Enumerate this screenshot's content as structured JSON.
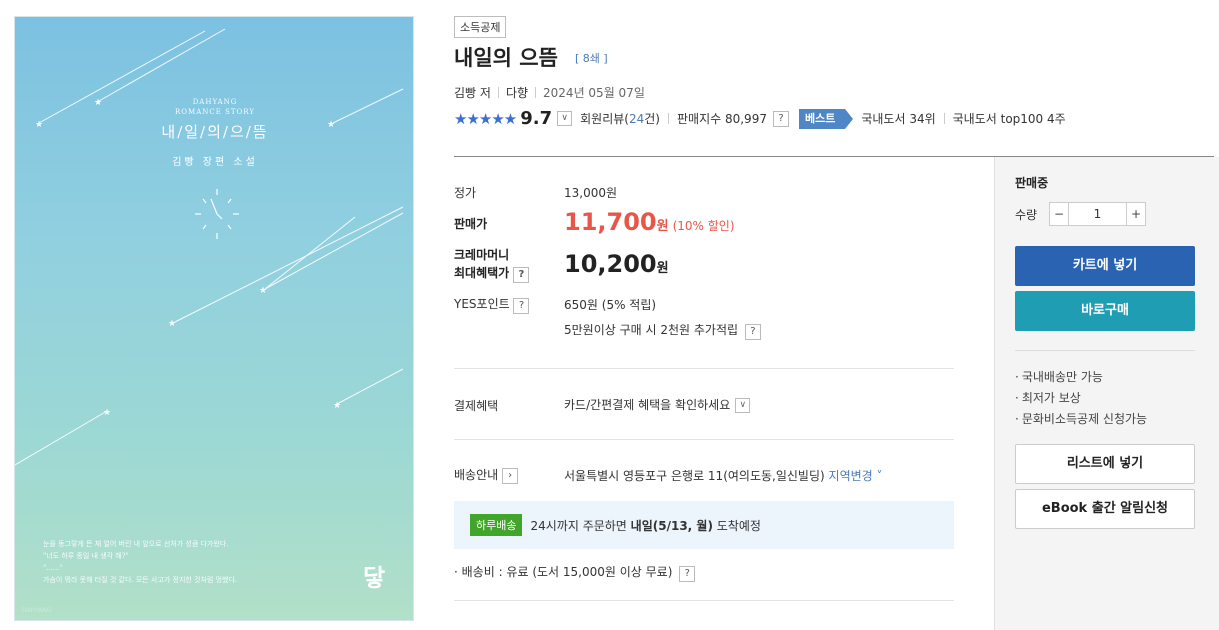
{
  "cover": {
    "publisher_line1": "DAHYANG",
    "publisher_line2": "ROMANCE STORY",
    "title": "내/일/의/으/뜸",
    "author": "김빵 장편 소설",
    "blurb_line1": "눈을 동그랗게 뜬 채 얼어 버린 내 앞으로 선처가 성큼 다가왔다.",
    "blurb_line2": "\"너도 하루 종일 내 생각 해?\"",
    "blurb_line3": "\"......\"",
    "blurb_line4": "가슴이 뭐라 못해 터질 것 같다. 모든 사고가 정지한 것처럼 멍했다.",
    "logo": "닿",
    "small_mark": "DAHYANG"
  },
  "product": {
    "badge": "소득공제",
    "title": "내일의 으뜸",
    "edition": "[ 8쇄 ]",
    "author": "김빵 저",
    "publisher": "다향",
    "date": "2024년 05월 07일",
    "stars": "★★★★★",
    "score": "9.7",
    "review_label": "회원리뷰(",
    "review_count": "24",
    "review_suffix": "건)",
    "sales_index": "판매지수 80,997",
    "best_tag": "베스트",
    "rank1": "국내도서 34위",
    "rank2": "국내도서 top100 4주"
  },
  "pricing": {
    "list_label": "정가",
    "list_price": "13,000원",
    "sale_label": "판매가",
    "sale_price": "11,700",
    "sale_unit": "원",
    "discount": "(10% 할인)",
    "max_label_1": "크레마머니",
    "max_label_2": "최대혜택가",
    "max_price": "10,200",
    "max_unit": "원",
    "points_label": "YES포인트",
    "points_value": "650원 (5% 적립)",
    "points_extra": "5만원이상 구매 시 2천원 추가적립",
    "qmark": "?"
  },
  "payment": {
    "label": "결제혜택",
    "value": "카드/간편결제 혜택을 확인하세요"
  },
  "delivery": {
    "label": "배송안내",
    "address": "서울특별시 영등포구 은행로 11(여의도동,일신빌딩)",
    "region_change": "지역변경",
    "same_day_tag": "하루배송",
    "same_day_text_1": "24시까지 주문하면 ",
    "same_day_text_bold": "내일(5/13, 월)",
    "same_day_text_2": " 도착예정",
    "fee": "· 배송비 : 유료 (도서 15,000원 이상 무료)"
  },
  "panel": {
    "status": "판매중",
    "qty_label": "수량",
    "qty_minus": "−",
    "qty_value": "1",
    "qty_plus": "+",
    "cart_button": "카트에 넣기",
    "buy_button": "바로구매",
    "notes": [
      "국내배송만 가능",
      "최저가 보상",
      "문화비소득공제 신청가능"
    ],
    "list_button": "리스트에 넣기",
    "ebook_button": "eBook 출간 알림신청"
  },
  "colors": {
    "accent_blue": "#2963b2",
    "buy_teal": "#1f9db3",
    "sale_red": "#e8564a",
    "same_day_green": "#40a52a"
  }
}
